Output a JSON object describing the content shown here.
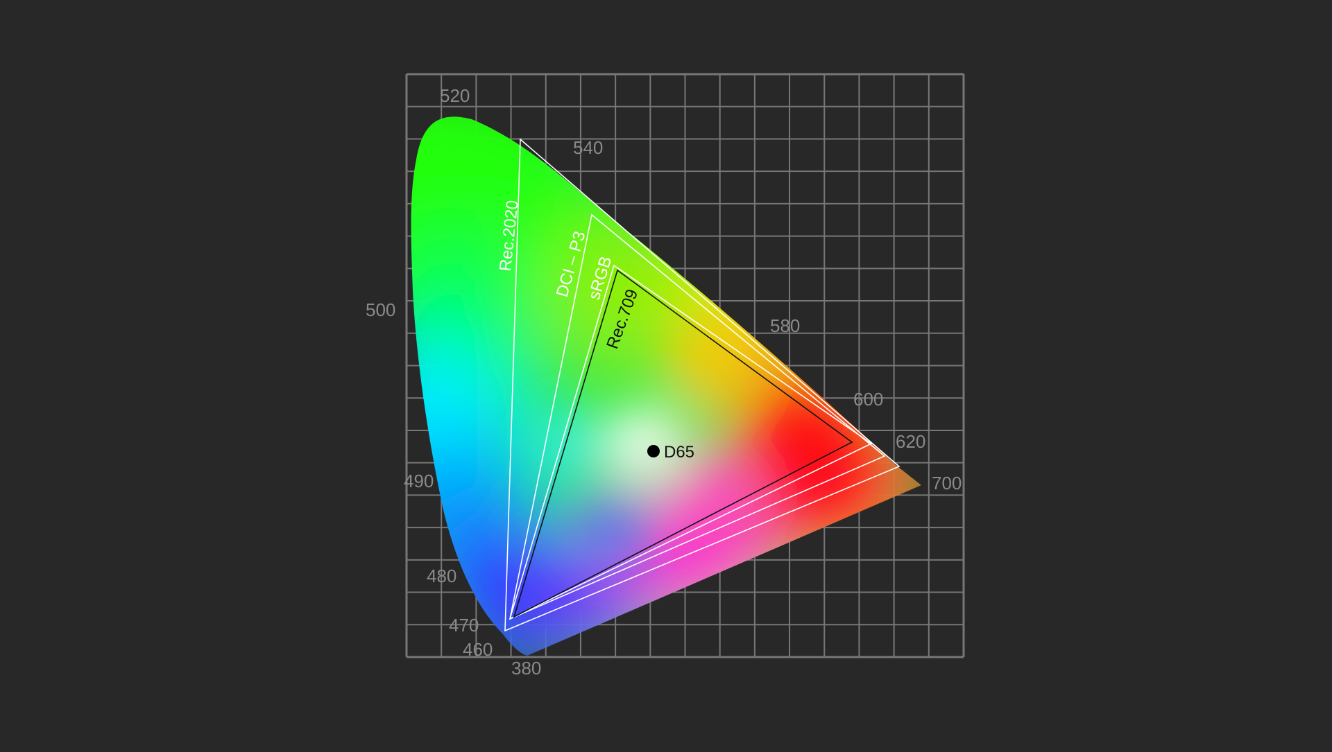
{
  "wavelength_labels": {
    "w520": "520",
    "w540": "540",
    "w500": "500",
    "w580": "580",
    "w600": "600",
    "w620": "620",
    "w700": "700",
    "w490": "490",
    "w480": "480",
    "w470": "470",
    "w460": "460",
    "w380": "380"
  },
  "gamuts": {
    "rec2020": "Rec.2020",
    "dcip3": "DCI – P3",
    "srgb": "sRGB",
    "rec709": "Rec.709"
  },
  "white_point": {
    "label": "D65"
  },
  "colors": {
    "background": "#282828",
    "grid": "#777777",
    "gamut_outline_light": "#ffffff",
    "gamut_outline_dark": "#111111"
  }
}
